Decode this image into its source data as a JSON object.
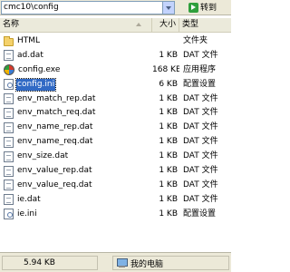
{
  "address": {
    "value": "cmc10\\config",
    "go_label": "转到"
  },
  "columns": {
    "name": "名称",
    "size": "大小",
    "type": "类型"
  },
  "files": [
    {
      "name": "HTML",
      "size": "",
      "type": "文件夹",
      "icon": "folder-icon"
    },
    {
      "name": "ad.dat",
      "size": "1 KB",
      "type": "DAT 文件",
      "icon": "file-icon"
    },
    {
      "name": "config.exe",
      "size": "168 KB",
      "type": "应用程序",
      "icon": "exe-icon"
    },
    {
      "name": "config.ini",
      "size": "6 KB",
      "type": "配置设置",
      "icon": "ini-icon",
      "selected": true
    },
    {
      "name": "env_match_rep.dat",
      "size": "1 KB",
      "type": "DAT 文件",
      "icon": "file-icon"
    },
    {
      "name": "env_match_req.dat",
      "size": "1 KB",
      "type": "DAT 文件",
      "icon": "file-icon"
    },
    {
      "name": "env_name_rep.dat",
      "size": "1 KB",
      "type": "DAT 文件",
      "icon": "file-icon"
    },
    {
      "name": "env_name_req.dat",
      "size": "1 KB",
      "type": "DAT 文件",
      "icon": "file-icon"
    },
    {
      "name": "env_size.dat",
      "size": "1 KB",
      "type": "DAT 文件",
      "icon": "file-icon"
    },
    {
      "name": "env_value_rep.dat",
      "size": "1 KB",
      "type": "DAT 文件",
      "icon": "file-icon"
    },
    {
      "name": "env_value_req.dat",
      "size": "1 KB",
      "type": "DAT 文件",
      "icon": "file-icon"
    },
    {
      "name": "ie.dat",
      "size": "1 KB",
      "type": "DAT 文件",
      "icon": "file-icon"
    },
    {
      "name": "ie.ini",
      "size": "1 KB",
      "type": "配置设置",
      "icon": "ini-icon"
    }
  ],
  "status": {
    "size": "5.94 KB",
    "location": "我的电脑"
  },
  "colors": {
    "selection": "#316ac5",
    "chrome": "#ece9d8"
  }
}
